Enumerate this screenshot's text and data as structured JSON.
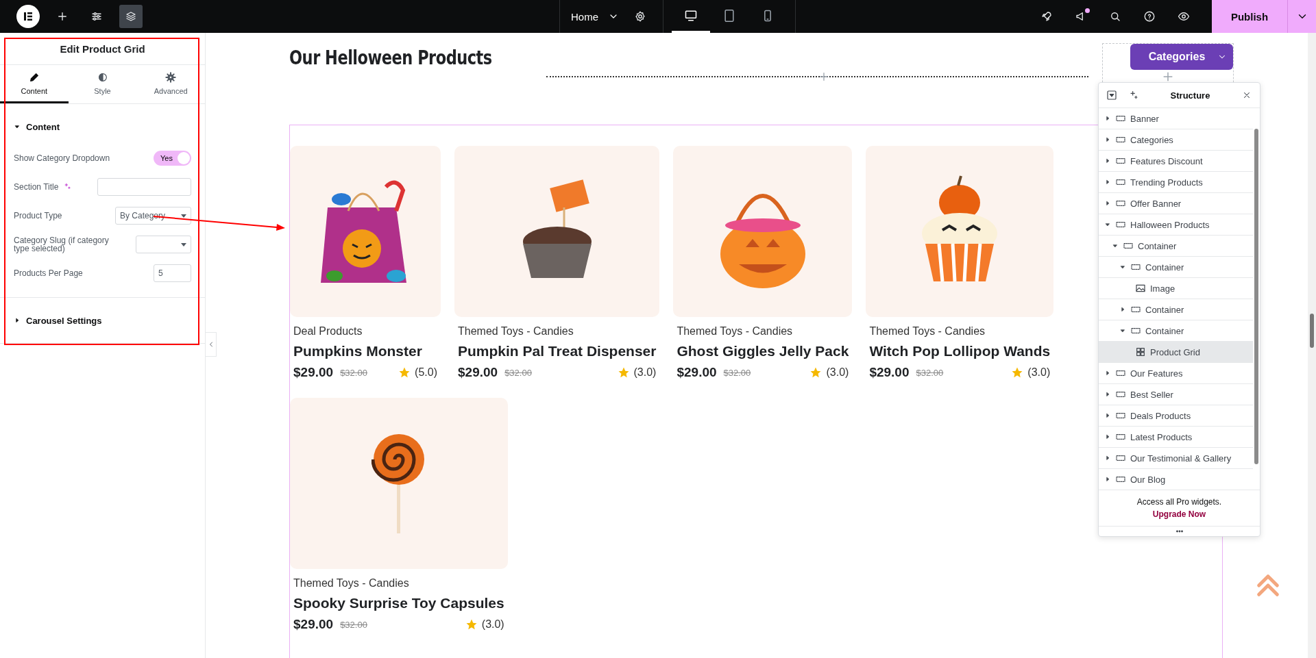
{
  "top_bar": {
    "page_selector": "Home",
    "devices": [
      {
        "kind": "desktop",
        "selected": true
      },
      {
        "kind": "tablet",
        "selected": false
      },
      {
        "kind": "mobile",
        "selected": false
      }
    ],
    "notification": true,
    "publish": "Publish"
  },
  "panel": {
    "title": "Edit Product Grid",
    "tabs": [
      {
        "label": "Content",
        "kind": "pencil",
        "selected": true
      },
      {
        "label": "Style",
        "kind": "contrast",
        "selected": false
      },
      {
        "label": "Advanced",
        "kind": "gear",
        "selected": false
      }
    ],
    "sections": [
      {
        "title": "Content",
        "expanded": true,
        "fields": [
          {
            "kind": "toggle",
            "label": "Show Category Dropdown",
            "on": true,
            "text": "Yes"
          },
          {
            "kind": "text",
            "label": "Section Title",
            "ai": true
          },
          {
            "kind": "select",
            "label": "Product Type",
            "value": "By Category"
          },
          {
            "kind": "select",
            "label": "Category Slug (if category type selected)"
          },
          {
            "kind": "number",
            "label": "Products Per Page",
            "value": "5"
          }
        ]
      },
      {
        "title": "Carousel Settings",
        "expanded": false
      }
    ]
  },
  "canvas": {
    "heading": "Our Helloween Products",
    "categories_button": "Categories",
    "products": [
      {
        "kind": "bag",
        "category": "Deal Products",
        "title": "Pumpkins Monster",
        "price": "$29.00",
        "old_price": "$32.00",
        "rating": "(5.0)"
      },
      {
        "kind": "cupcake",
        "category": "Themed Toys - Candies",
        "title": "Pumpkin Pal Treat Dispenser",
        "price": "$29.00",
        "old_price": "$32.00",
        "rating": "(3.0)"
      },
      {
        "kind": "basket",
        "category": "Themed Toys - Candies",
        "title": "Ghost Giggles Jelly Pack",
        "price": "$29.00",
        "old_price": "$32.00",
        "rating": "(3.0)"
      },
      {
        "kind": "pumpkin-cupcake",
        "category": "Themed Toys - Candies",
        "title": "Witch Pop Lollipop Wands",
        "price": "$29.00",
        "old_price": "$32.00",
        "rating": "(3.0)"
      },
      {
        "kind": "lollipop",
        "category": "Themed Toys - Candies",
        "title": "Spooky Surprise Toy Capsules",
        "price": "$29.00",
        "old_price": "$32.00",
        "rating": "(3.0)"
      }
    ]
  },
  "structure": {
    "title": "Structure",
    "items": [
      {
        "label": "Banner",
        "kind": "container",
        "expanded": false,
        "selected": false
      },
      {
        "label": "Categories",
        "kind": "container",
        "expanded": false,
        "selected": false
      },
      {
        "label": "Features Discount",
        "kind": "container",
        "expanded": false,
        "selected": false
      },
      {
        "label": "Trending Products",
        "kind": "container",
        "expanded": false,
        "selected": false
      },
      {
        "label": "Offer Banner",
        "kind": "container",
        "expanded": false,
        "selected": false
      },
      {
        "label": "Halloween Products",
        "kind": "container",
        "expanded": true,
        "selected": false,
        "children": [
          {
            "label": "Container",
            "kind": "container",
            "expanded": true,
            "selected": false,
            "children": [
              {
                "label": "Container",
                "kind": "container",
                "expanded": true,
                "selected": false,
                "children": [
                  {
                    "label": "Image",
                    "kind": "image",
                    "selected": false
                  }
                ]
              },
              {
                "label": "Container",
                "kind": "container",
                "expanded": false,
                "selected": false
              },
              {
                "label": "Container",
                "kind": "container",
                "expanded": true,
                "selected": false,
                "children": [
                  {
                    "label": "Product Grid",
                    "kind": "grid",
                    "selected": true
                  }
                ]
              }
            ]
          }
        ]
      },
      {
        "label": "Our Features",
        "kind": "container",
        "expanded": false,
        "selected": false
      },
      {
        "label": "Best Seller",
        "kind": "container",
        "expanded": false,
        "selected": false
      },
      {
        "label": "Deals Products",
        "kind": "container",
        "expanded": false,
        "selected": false
      },
      {
        "label": "Latest Products",
        "kind": "container",
        "expanded": false,
        "selected": false
      },
      {
        "label": "Our Testimonial & Gallery",
        "kind": "container",
        "expanded": false,
        "selected": false
      },
      {
        "label": "Our Blog",
        "kind": "container",
        "expanded": false,
        "selected": false
      }
    ],
    "promo": "Access all Pro widgets.",
    "promo_link": "Upgrade Now"
  }
}
